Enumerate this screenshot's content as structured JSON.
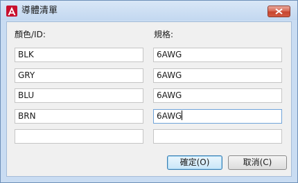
{
  "window": {
    "title": "導體清單",
    "icon": "autocad-a-icon"
  },
  "headers": {
    "color_id": "顏色/ID:",
    "spec": "規格:"
  },
  "rows": [
    {
      "color": "BLK",
      "spec": "6AWG"
    },
    {
      "color": "GRY",
      "spec": "6AWG"
    },
    {
      "color": "BLU",
      "spec": "6AWG"
    },
    {
      "color": "BRN",
      "spec": "6AWG"
    },
    {
      "color": "",
      "spec": ""
    }
  ],
  "buttons": {
    "ok": "確定(O)",
    "cancel": "取消(C)"
  },
  "colors": {
    "frame": "#c9dcf2",
    "close_button": "#c7452f",
    "default_button_border": "#3c7fb1",
    "app_icon": "#c8102e"
  }
}
